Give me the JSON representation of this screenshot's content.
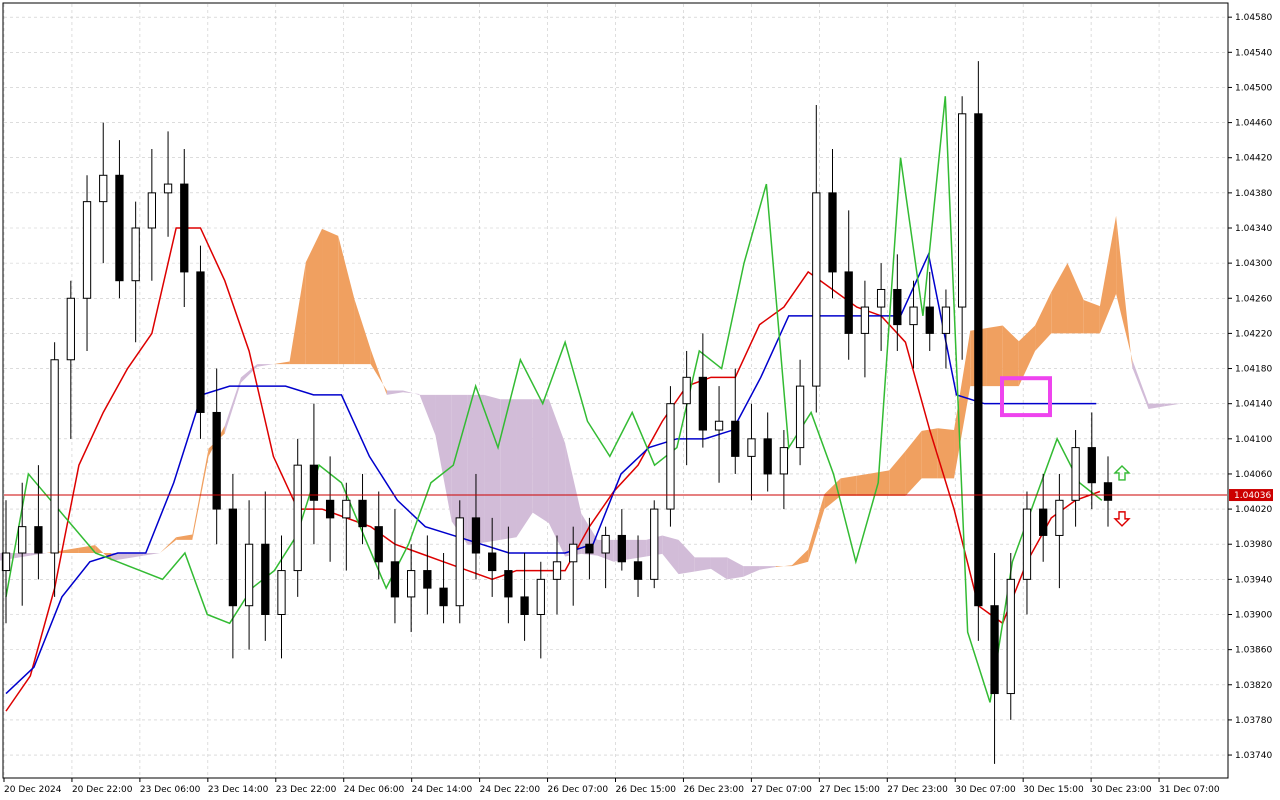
{
  "colors": {
    "background": "#ffffff",
    "grid": "#c8c8c8",
    "candle_bull_body": "#ffffff",
    "candle_bear_body": "#000000",
    "candle_outline": "#000000",
    "cloud_bullish": "#f0a060",
    "cloud_bearish": "#d2bcd8",
    "tenkan_sen": "#dd0000",
    "kijun_sen": "#0000cc",
    "chikou_span": "#33bb33",
    "second_kijun": "#1e5a50",
    "second_tenkan": "#ff55aa",
    "current_price_line": "#cc0000",
    "highlight_box": "#ee44ee",
    "arrow_up": "#33bb33",
    "arrow_down": "#dd0000"
  },
  "icons": [
    "arrow-up-icon",
    "arrow-down-icon"
  ],
  "chart_data": {
    "type": "candlestick",
    "title": "",
    "xlabel": "",
    "ylabel": "",
    "ylim": [
      1.03715,
      1.04595
    ],
    "grid": true,
    "y_ticks": [
      "1.04580",
      "1.04540",
      "1.04500",
      "1.04460",
      "1.04420",
      "1.04380",
      "1.04340",
      "1.04300",
      "1.04260",
      "1.04220",
      "1.04180",
      "1.04140",
      "1.04100",
      "1.04060",
      "1.04020",
      "1.03980",
      "1.03940",
      "1.03900",
      "1.03860",
      "1.03820",
      "1.03780",
      "1.03740"
    ],
    "x_ticks": [
      "20 Dec 2024",
      "20 Dec 22:00",
      "23 Dec 06:00",
      "23 Dec 14:00",
      "23 Dec 22:00",
      "24 Dec 06:00",
      "24 Dec 14:00",
      "24 Dec 22:00",
      "26 Dec 07:00",
      "26 Dec 15:00",
      "26 Dec 23:00",
      "27 Dec 07:00",
      "27 Dec 15:00",
      "27 Dec 23:00",
      "30 Dec 07:00",
      "30 Dec 15:00",
      "30 Dec 23:00",
      "31 Dec 07:00"
    ],
    "current_price": "1.04036",
    "candles": [
      [
        1.0395,
        1.0403,
        1.0389,
        1.0397
      ],
      [
        1.0397,
        1.0405,
        1.0391,
        1.04
      ],
      [
        1.04,
        1.0407,
        1.0394,
        1.0397
      ],
      [
        1.0397,
        1.0421,
        1.0392,
        1.0419
      ],
      [
        1.0419,
        1.0428,
        1.041,
        1.0426
      ],
      [
        1.0426,
        1.044,
        1.042,
        1.0437
      ],
      [
        1.0437,
        1.0446,
        1.043,
        1.044
      ],
      [
        1.044,
        1.0444,
        1.0426,
        1.0428
      ],
      [
        1.0428,
        1.0437,
        1.0421,
        1.0434
      ],
      [
        1.0434,
        1.0443,
        1.0428,
        1.0438
      ],
      [
        1.0438,
        1.0445,
        1.0433,
        1.0439
      ],
      [
        1.0439,
        1.0443,
        1.0425,
        1.0429
      ],
      [
        1.0429,
        1.0432,
        1.041,
        1.0413
      ],
      [
        1.0413,
        1.0418,
        1.0398,
        1.0402
      ],
      [
        1.0402,
        1.0406,
        1.0385,
        1.0391
      ],
      [
        1.0391,
        1.0403,
        1.0386,
        1.0398
      ],
      [
        1.0398,
        1.0404,
        1.0387,
        1.039
      ],
      [
        1.039,
        1.0399,
        1.0385,
        1.0395
      ],
      [
        1.0395,
        1.041,
        1.0392,
        1.0407
      ],
      [
        1.0407,
        1.0414,
        1.0398,
        1.0403
      ],
      [
        1.0403,
        1.0408,
        1.0396,
        1.0401
      ],
      [
        1.0401,
        1.0405,
        1.0395,
        1.0403
      ],
      [
        1.0403,
        1.0406,
        1.0398,
        1.04
      ],
      [
        1.04,
        1.0404,
        1.0394,
        1.0396
      ],
      [
        1.0396,
        1.0402,
        1.0389,
        1.0392
      ],
      [
        1.0392,
        1.0398,
        1.0388,
        1.0395
      ],
      [
        1.0395,
        1.0399,
        1.039,
        1.0393
      ],
      [
        1.0393,
        1.0397,
        1.0389,
        1.0391
      ],
      [
        1.0391,
        1.0403,
        1.0389,
        1.0401
      ],
      [
        1.0401,
        1.0406,
        1.0394,
        1.0397
      ],
      [
        1.0397,
        1.0401,
        1.0392,
        1.0395
      ],
      [
        1.0395,
        1.04,
        1.0389,
        1.0392
      ],
      [
        1.0392,
        1.0397,
        1.0387,
        1.039
      ],
      [
        1.039,
        1.0396,
        1.0385,
        1.0394
      ],
      [
        1.0394,
        1.0399,
        1.039,
        1.0396
      ],
      [
        1.0396,
        1.04,
        1.0391,
        1.0398
      ],
      [
        1.0398,
        1.0401,
        1.0394,
        1.0397
      ],
      [
        1.0397,
        1.04,
        1.0393,
        1.0399
      ],
      [
        1.0399,
        1.0402,
        1.0395,
        1.0396
      ],
      [
        1.0396,
        1.0399,
        1.0392,
        1.0394
      ],
      [
        1.0394,
        1.0403,
        1.0393,
        1.0402
      ],
      [
        1.0402,
        1.0416,
        1.04,
        1.0414
      ],
      [
        1.0414,
        1.042,
        1.0407,
        1.0417
      ],
      [
        1.0417,
        1.0422,
        1.0409,
        1.0411
      ],
      [
        1.0411,
        1.0416,
        1.0405,
        1.0412
      ],
      [
        1.0412,
        1.0418,
        1.0406,
        1.0408
      ],
      [
        1.0408,
        1.0414,
        1.0403,
        1.041
      ],
      [
        1.041,
        1.0413,
        1.0404,
        1.0406
      ],
      [
        1.0406,
        1.0411,
        1.0402,
        1.0409
      ],
      [
        1.0409,
        1.0419,
        1.0407,
        1.0416
      ],
      [
        1.0416,
        1.0448,
        1.0413,
        1.0438
      ],
      [
        1.0438,
        1.0443,
        1.0426,
        1.0429
      ],
      [
        1.0429,
        1.0436,
        1.0419,
        1.0422
      ],
      [
        1.0422,
        1.0428,
        1.0417,
        1.0425
      ],
      [
        1.0425,
        1.043,
        1.042,
        1.0427
      ],
      [
        1.0427,
        1.0431,
        1.042,
        1.0423
      ],
      [
        1.0423,
        1.0428,
        1.0418,
        1.0425
      ],
      [
        1.0425,
        1.0429,
        1.042,
        1.0422
      ],
      [
        1.0422,
        1.0427,
        1.0418,
        1.0425
      ],
      [
        1.0425,
        1.0449,
        1.0419,
        1.0447
      ],
      [
        1.0447,
        1.0453,
        1.0387,
        1.0391
      ],
      [
        1.0391,
        1.0397,
        1.0373,
        1.0381
      ],
      [
        1.0381,
        1.0397,
        1.0378,
        1.0394
      ],
      [
        1.0394,
        1.0404,
        1.039,
        1.0402
      ],
      [
        1.0402,
        1.0406,
        1.0396,
        1.0399
      ],
      [
        1.0399,
        1.0406,
        1.0393,
        1.0403
      ],
      [
        1.0403,
        1.0411,
        1.04,
        1.0409
      ],
      [
        1.0409,
        1.0413,
        1.0402,
        1.0405
      ],
      [
        1.0405,
        1.0408,
        1.04,
        1.0403
      ]
    ],
    "series": [
      {
        "name": "",
        "role": "tenkan_sen",
        "values": [
          1.0379,
          1.0383,
          1.0393,
          1.0407,
          1.0413,
          1.0418,
          1.0422,
          1.0434,
          1.0434,
          1.0428,
          1.042,
          1.0408,
          1.0402,
          1.0402,
          1.0401,
          1.04,
          1.0398,
          1.0397,
          1.0396,
          1.0395,
          1.0394,
          1.0395,
          1.0395,
          1.0395,
          1.04,
          1.0404,
          1.0407,
          1.0412,
          1.0416,
          1.0417,
          1.0417,
          1.0423,
          1.0425,
          1.0429,
          1.0427,
          1.0425,
          1.0424,
          1.0421,
          1.0411,
          1.0402,
          1.0391,
          1.0389,
          1.0396,
          1.0401,
          1.0403,
          1.0404
        ]
      },
      {
        "name": "",
        "role": "kijun_sen",
        "values": [
          1.0381,
          1.0384,
          1.0392,
          1.0396,
          1.0397,
          1.0397,
          1.0405,
          1.0415,
          1.0416,
          1.0416,
          1.0416,
          1.0415,
          1.0415,
          1.0408,
          1.0403,
          1.04,
          1.0399,
          1.0398,
          1.0397,
          1.0397,
          1.0397,
          1.0398,
          1.0406,
          1.0409,
          1.041,
          1.041,
          1.0411,
          1.0417,
          1.0424,
          1.0424,
          1.0424,
          1.0424,
          1.0424,
          1.0431,
          1.0415,
          1.0414,
          1.0414,
          1.0414,
          1.0414,
          1.0414
        ]
      },
      {
        "name": "",
        "role": "chikou_span",
        "values": [
          1.0392,
          1.0406,
          1.0403,
          1.04,
          1.0397,
          1.0396,
          1.0395,
          1.0394,
          1.0397,
          1.039,
          1.0389,
          1.0393,
          1.0395,
          1.0399,
          1.0407,
          1.0405,
          1.0399,
          1.0393,
          1.0398,
          1.0405,
          1.0407,
          1.0416,
          1.0409,
          1.0419,
          1.0414,
          1.0421,
          1.0412,
          1.0408,
          1.0413,
          1.0407,
          1.0409,
          1.042,
          1.0418,
          1.043,
          1.0439,
          1.0409,
          1.0413,
          1.0406,
          1.0396,
          1.0405,
          1.0442,
          1.0424,
          1.0449,
          1.0388,
          1.038,
          1.0396,
          1.0403,
          1.041,
          1.0405,
          1.0403
        ]
      }
    ]
  }
}
